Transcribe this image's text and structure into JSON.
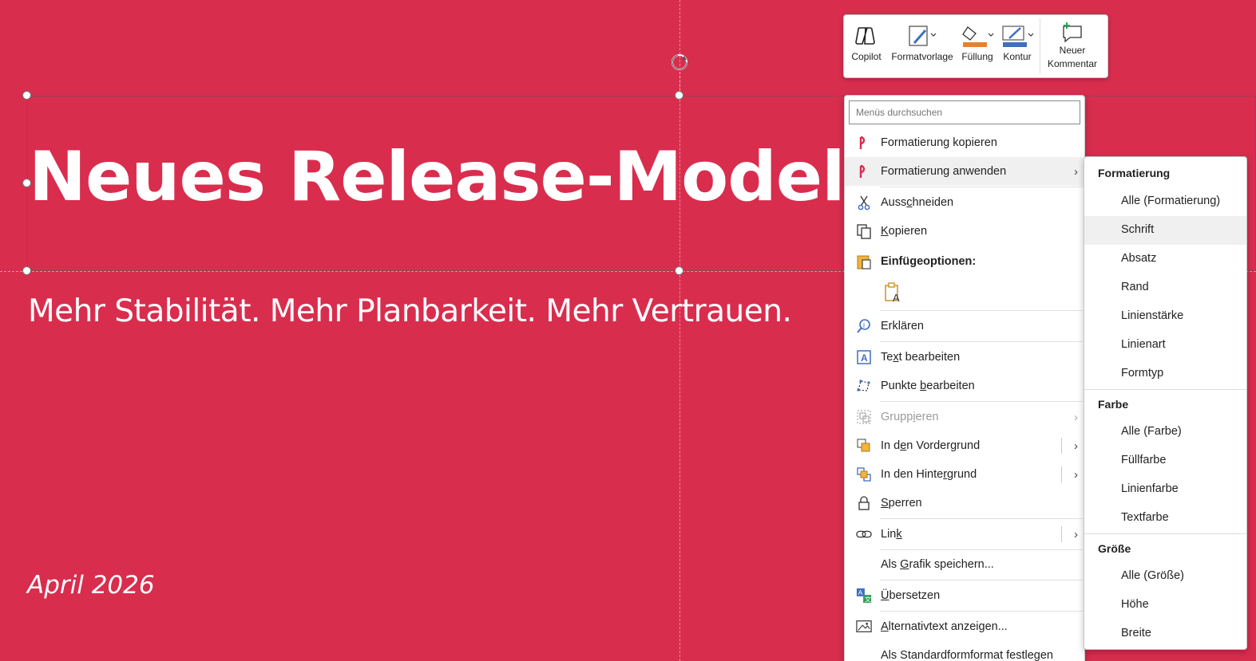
{
  "slide": {
    "title": "Neues Release-Modell",
    "subtitle": "Mehr Stabilität. Mehr Planbarkeit. Mehr Vertrauen.",
    "date": "April 2026",
    "background_color": "#D92D4E"
  },
  "mini_toolbar": {
    "copilot": "Copilot",
    "format_template": "Formatvorlage",
    "fill": "Füllung",
    "outline": "Kontur",
    "new_comment_line1": "Neuer",
    "new_comment_line2": "Kommentar",
    "fill_color": "#E8802E",
    "outline_color": "#3F6FC1"
  },
  "context_menu": {
    "search_placeholder": "Menüs durchsuchen",
    "items": {
      "copy_format": "Formatierung kopieren",
      "apply_format": "Formatierung anwenden",
      "cut_pre": "Auss",
      "cut_u": "c",
      "cut_post": "hneiden",
      "copy_pre": "",
      "copy_u": "K",
      "copy_post": "opieren",
      "paste_options": "Einfügeoptionen:",
      "explain": "Erklären",
      "edit_text_pre": "Te",
      "edit_text_u": "x",
      "edit_text_post": "t bearbeiten",
      "edit_points_pre": "Punkte ",
      "edit_points_u": "b",
      "edit_points_post": "earbeiten",
      "group_pre": "Grupp",
      "group_u": "i",
      "group_post": "eren",
      "bring_front_pre": "In d",
      "bring_front_u": "e",
      "bring_front_post": "n Vordergrund",
      "send_back_pre": "In den Hinte",
      "send_back_u": "r",
      "send_back_post": "grund",
      "lock_pre": "",
      "lock_u": "S",
      "lock_post": "perren",
      "link_pre": "Lin",
      "link_u": "k",
      "link_post": "",
      "save_graphic_pre": "Als ",
      "save_graphic_u": "G",
      "save_graphic_post": "rafik speichern...",
      "translate_pre": "",
      "translate_u": "Ü",
      "translate_post": "bersetzen",
      "alt_text_pre": "",
      "alt_text_u": "A",
      "alt_text_post": "lternativtext anzeigen...",
      "set_default": "Als Standardformformat festlegen"
    }
  },
  "submenu": {
    "sections": {
      "formatting": {
        "heading": "Formatierung",
        "items": [
          "Alle (Formatierung)",
          "Schrift",
          "Absatz",
          "Rand",
          "Linienstärke",
          "Linienart",
          "Formtyp"
        ]
      },
      "color": {
        "heading": "Farbe",
        "items": [
          "Alle (Farbe)",
          "Füllfarbe",
          "Linienfarbe",
          "Textfarbe"
        ]
      },
      "size": {
        "heading": "Größe",
        "items": [
          "Alle (Größe)",
          "Höhe",
          "Breite"
        ]
      }
    }
  }
}
